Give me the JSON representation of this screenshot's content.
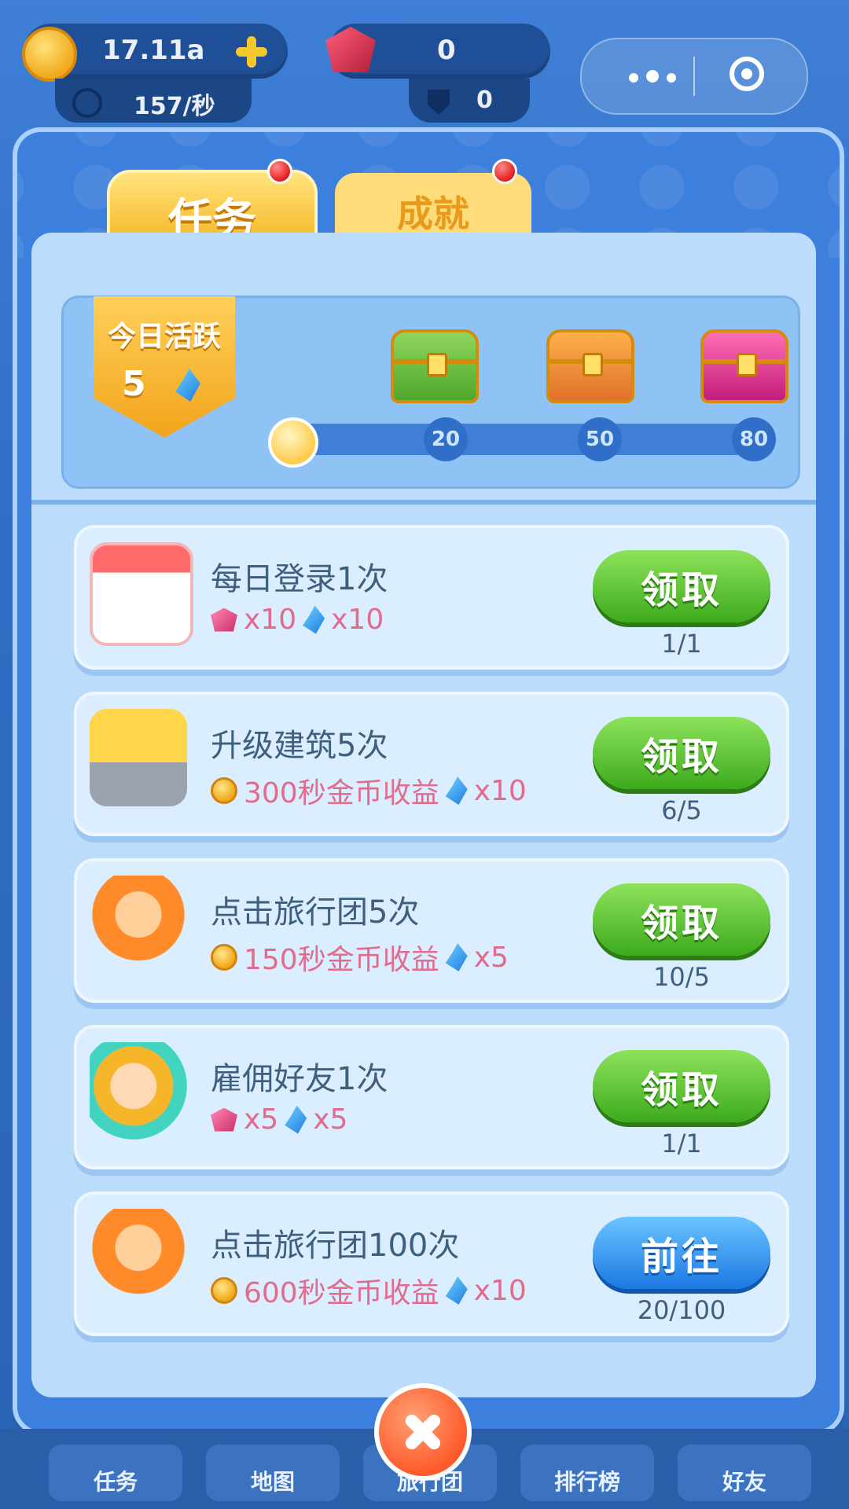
{
  "hud": {
    "coins": "17.11a",
    "rate": "157/秒",
    "gems": "0",
    "shield": "0"
  },
  "tabs": [
    {
      "label": "任务",
      "active": true
    },
    {
      "label": "成就",
      "active": false
    }
  ],
  "activity": {
    "title": "今日活跃",
    "value": "5",
    "markers": [
      "20",
      "50",
      "80"
    ],
    "progress_fraction": 0.0625
  },
  "tasks": [
    {
      "title": "每日登录1次",
      "reward_a": "x10",
      "reward_b": "x10",
      "reward_a_type": "gem",
      "button": "领取",
      "button_style": "green",
      "progress": "1/1"
    },
    {
      "title": "升级建筑5次",
      "reward_a": "300秒金币收益",
      "reward_b": "x10",
      "reward_a_type": "coin",
      "button": "领取",
      "button_style": "green",
      "progress": "6/5"
    },
    {
      "title": "点击旅行团5次",
      "reward_a": "150秒金币收益",
      "reward_b": "x5",
      "reward_a_type": "coin",
      "button": "领取",
      "button_style": "green",
      "progress": "10/5"
    },
    {
      "title": "雇佣好友1次",
      "reward_a": "x5",
      "reward_b": "x5",
      "reward_a_type": "gem",
      "button": "领取",
      "button_style": "green",
      "progress": "1/1"
    },
    {
      "title": "点击旅行团100次",
      "reward_a": "600秒金币收益",
      "reward_b": "x10",
      "reward_a_type": "coin",
      "button": "前往",
      "button_style": "blue",
      "progress": "20/100"
    }
  ],
  "nav": [
    "任务",
    "地图",
    "旅行团",
    "排行榜",
    "好友"
  ],
  "colors": {
    "green_button": "#3daa1d",
    "blue_button": "#1b78e2",
    "reward_text": "#e26b8c",
    "panel": "#3d7fdc"
  }
}
